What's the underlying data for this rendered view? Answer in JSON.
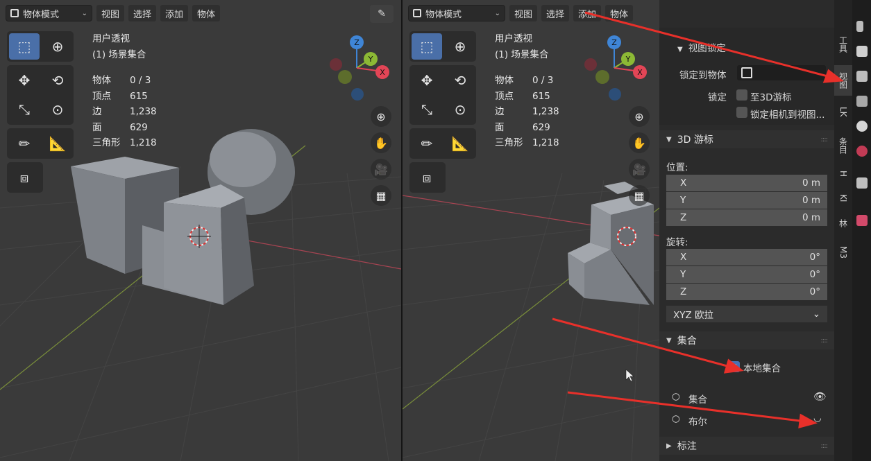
{
  "left": {
    "mode_label": "物体模式",
    "menus": [
      "视图",
      "选择",
      "添加",
      "物体"
    ],
    "view_name": "用户透视",
    "collection_line": "(1) 场景集合",
    "stats": [
      {
        "label": "物体",
        "value": "0 / 3"
      },
      {
        "label": "顶点",
        "value": "615"
      },
      {
        "label": "边",
        "value": "1,238"
      },
      {
        "label": "面",
        "value": "629"
      },
      {
        "label": "三角形",
        "value": "1,218"
      }
    ]
  },
  "right": {
    "mode_label": "物体模式",
    "menus": [
      "视图",
      "选择",
      "添加",
      "物体"
    ],
    "view_name": "用户透视",
    "collection_line": "(1) 场景集合",
    "stats": [
      {
        "label": "物体",
        "value": "0 / 3"
      },
      {
        "label": "顶点",
        "value": "615"
      },
      {
        "label": "边",
        "value": "1,238"
      },
      {
        "label": "面",
        "value": "629"
      },
      {
        "label": "三角形",
        "value": "1,218"
      }
    ]
  },
  "gizmo": {
    "z": "Z",
    "y": "Y",
    "x": "X"
  },
  "npanel": {
    "view_lock": {
      "title": "视图锁定",
      "lock_to_object_label": "锁定到物体",
      "lock_label": "锁定",
      "to_3d_cursor": "至3D游标",
      "lock_camera": "锁定相机到视图..."
    },
    "cursor": {
      "title": "3D 游标",
      "location_label": "位置:",
      "location": [
        {
          "axis": "X",
          "value": "0 m"
        },
        {
          "axis": "Y",
          "value": "0 m"
        },
        {
          "axis": "Z",
          "value": "0 m"
        }
      ],
      "rotation_label": "旋转:",
      "rotation": [
        {
          "axis": "X",
          "value": "0°"
        },
        {
          "axis": "Y",
          "value": "0°"
        },
        {
          "axis": "Z",
          "value": "0°"
        }
      ],
      "rotation_mode": "XYZ 欧拉"
    },
    "collections": {
      "title": "集合",
      "local_collection": "本地集合",
      "local_collection_checked": true,
      "items": [
        "集合",
        "布尔"
      ]
    },
    "annotation": {
      "title": "标注"
    }
  },
  "tabs": [
    "工具",
    "视图",
    "LK",
    "条目",
    "H",
    "KI",
    "林",
    "M3"
  ],
  "active_tab": "视图",
  "colors": {
    "accent": "#4772b3",
    "arrow": "#e8302a",
    "x_axis": "#e24556",
    "y_axis": "#8cb935",
    "z_axis": "#3f85d6"
  }
}
